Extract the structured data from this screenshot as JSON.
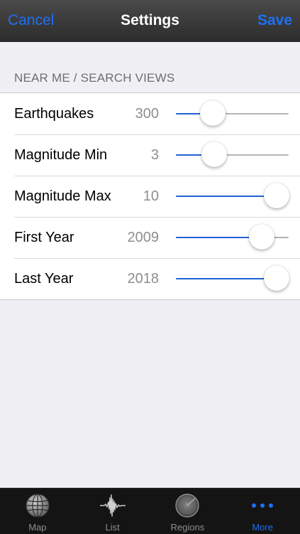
{
  "navbar": {
    "cancel_label": "Cancel",
    "title": "Settings",
    "save_label": "Save"
  },
  "section": {
    "header": "NEAR ME / SEARCH VIEWS",
    "rows": [
      {
        "label": "Earthquakes",
        "value": "300",
        "slider_fraction": 0.33
      },
      {
        "label": "Magnitude Min",
        "value": "3",
        "slider_fraction": 0.34
      },
      {
        "label": "Magnitude Max",
        "value": "10",
        "slider_fraction": 0.89
      },
      {
        "label": "First Year",
        "value": "2009",
        "slider_fraction": 0.76
      },
      {
        "label": "Last Year",
        "value": "2018",
        "slider_fraction": 0.89
      }
    ]
  },
  "tabbar": {
    "tabs": [
      {
        "label": "Map",
        "icon": "globe-icon"
      },
      {
        "label": "List",
        "icon": "waveform-icon"
      },
      {
        "label": "Regions",
        "icon": "radar-icon"
      },
      {
        "label": "More",
        "icon": "more-dots-icon",
        "active": true
      }
    ]
  },
  "colors": {
    "accent": "#1e6ff2",
    "slider_fill": "#1e63d6",
    "navbar": "#3a3a3a",
    "background": "#efeff4"
  }
}
